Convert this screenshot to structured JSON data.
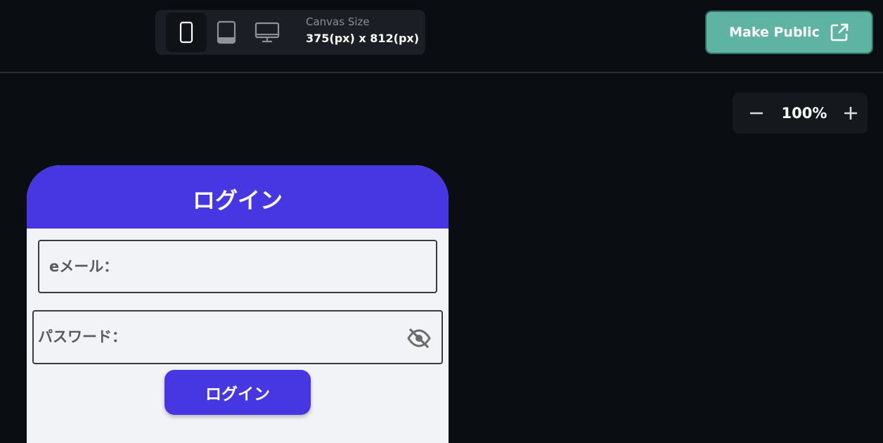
{
  "toolbar": {
    "devices": [
      {
        "name": "phone",
        "icon": "phone-icon",
        "active": true
      },
      {
        "name": "tablet",
        "icon": "tablet-icon",
        "active": false
      },
      {
        "name": "desktop",
        "icon": "desktop-icon",
        "active": false
      }
    ],
    "canvas_size_label": "Canvas Size",
    "canvas_size_value": "375(px) x 812(px)",
    "make_public_label": "Make Public",
    "make_public_icon": "external-link-icon"
  },
  "zoom": {
    "value": "100%",
    "out_icon": "minus-icon",
    "in_icon": "plus-icon"
  },
  "app": {
    "title": "ログイン",
    "email_label": "eメール：",
    "password_label": "パスワード：",
    "password_toggle_icon": "eye-off-icon",
    "login_button_label": "ログイン"
  },
  "colors": {
    "background": "#0a0e13",
    "accent": "#4737e2",
    "make_public": "#5fb3a3",
    "app_background": "#f2f3f7"
  }
}
